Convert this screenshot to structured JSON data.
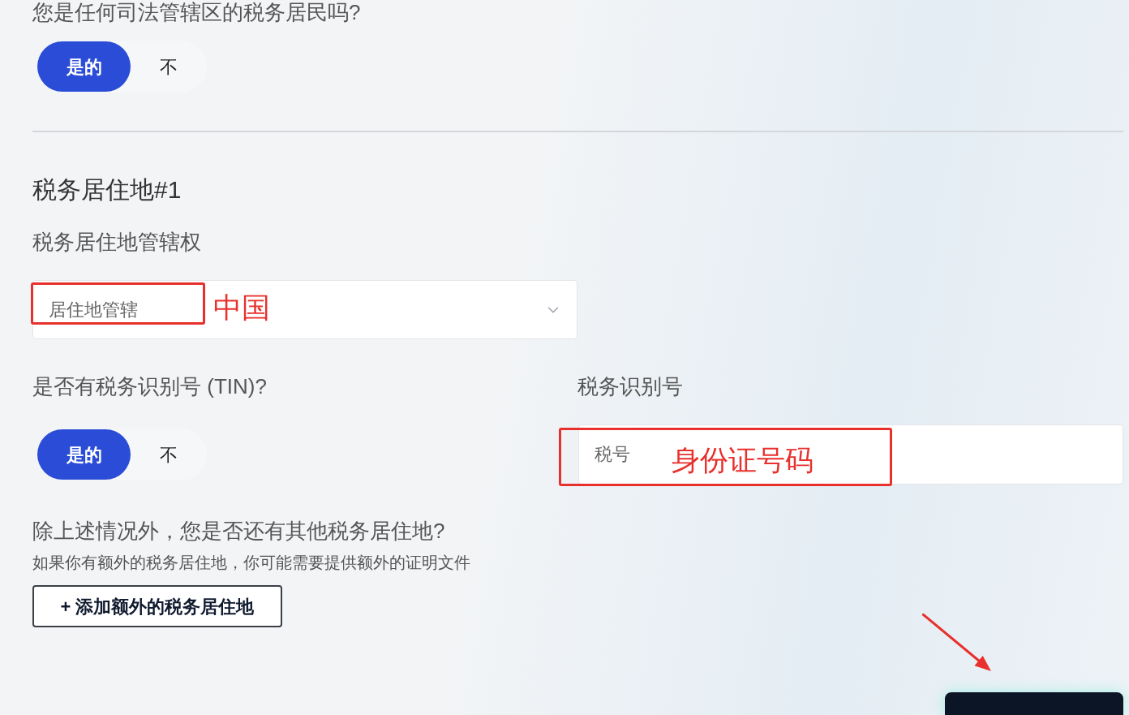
{
  "tax_resident_question": {
    "label": "您是任何司法管辖区的税务居民吗?",
    "options": [
      {
        "label": "是的",
        "selected": true
      },
      {
        "label": "不",
        "selected": false
      }
    ]
  },
  "residence": {
    "title": "税务居住地#1",
    "jurisdiction": {
      "label": "税务居住地管辖权",
      "placeholder": "居住地管辖",
      "highlighted": true,
      "annotation": "中国"
    },
    "tin_question": {
      "label": "是否有税务识别号 (TIN)?",
      "options": [
        {
          "label": "是的",
          "selected": true
        },
        {
          "label": "不",
          "selected": false
        }
      ]
    },
    "tin": {
      "label": "税务识别号",
      "placeholder": "税号",
      "highlighted": true,
      "annotation": "身份证号码"
    }
  },
  "additional": {
    "question": "除上述情况外，您是否还有其他税务居住地?",
    "hint": "如果你有额外的税务居住地，你可能需要提供额外的证明文件",
    "add_button": "+ 添加额外的税务居住地"
  }
}
